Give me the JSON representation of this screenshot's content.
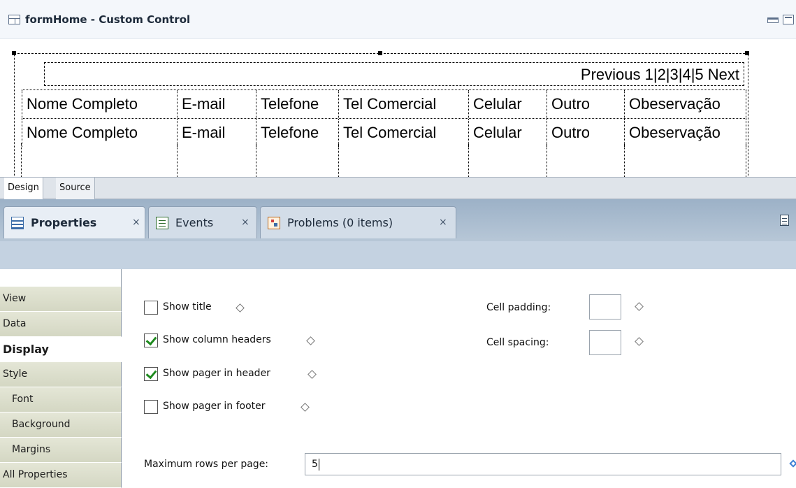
{
  "editor": {
    "title": "formHome - Custom Control",
    "pager_text": "Previous 1|2|3|4|5 Next",
    "columns": [
      "Nome Completo",
      "E-mail",
      "Telefone",
      "Tel Comercial",
      "Celular",
      "Outro",
      "Obeservação"
    ]
  },
  "editor_tabs": [
    "Design",
    "Source"
  ],
  "view_tabs": [
    {
      "label": "Properties",
      "icon": "properties-table-icon",
      "close": "×"
    },
    {
      "label": "Events",
      "icon": "events-icon",
      "close": "×"
    },
    {
      "label": "Problems (0 items)",
      "icon": "problems-icon",
      "close": "×"
    }
  ],
  "nav": [
    "View",
    "Data",
    "Display",
    "Style",
    "Font",
    "Background",
    "Margins",
    "All Properties"
  ],
  "nav_selected": "Display",
  "options": [
    {
      "label": "Show title",
      "checked": false
    },
    {
      "label": "Show column headers",
      "checked": true
    },
    {
      "label": "Show pager in header",
      "checked": true
    },
    {
      "label": "Show pager in footer",
      "checked": false
    }
  ],
  "fields": {
    "cell_padding_label": "Cell padding:",
    "cell_padding_value": "",
    "cell_spacing_label": "Cell spacing:",
    "cell_spacing_value": "",
    "max_rows_label": "Maximum rows per page:",
    "max_rows_value": "5"
  },
  "colors": {
    "checkmark": "#1e8a1e",
    "nav_bg": "#d9dcc8",
    "view_tabs_bg": "#a8bccf"
  }
}
